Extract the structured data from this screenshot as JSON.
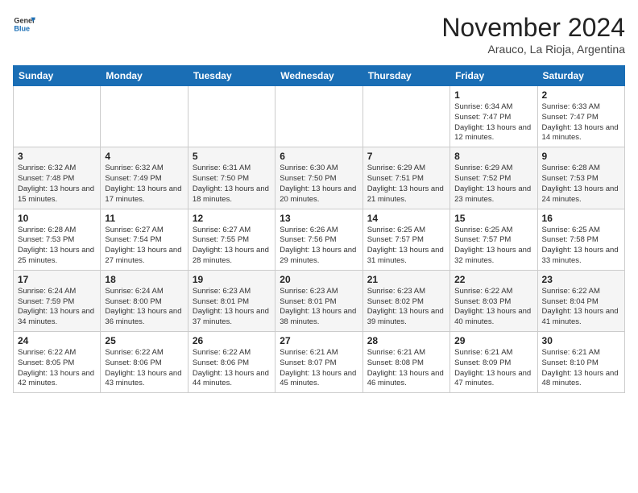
{
  "logo": {
    "line1": "General",
    "line2": "Blue"
  },
  "title": "November 2024",
  "subtitle": "Arauco, La Rioja, Argentina",
  "headers": [
    "Sunday",
    "Monday",
    "Tuesday",
    "Wednesday",
    "Thursday",
    "Friday",
    "Saturday"
  ],
  "weeks": [
    [
      {
        "day": "",
        "info": ""
      },
      {
        "day": "",
        "info": ""
      },
      {
        "day": "",
        "info": ""
      },
      {
        "day": "",
        "info": ""
      },
      {
        "day": "",
        "info": ""
      },
      {
        "day": "1",
        "info": "Sunrise: 6:34 AM\nSunset: 7:47 PM\nDaylight: 13 hours and 12 minutes."
      },
      {
        "day": "2",
        "info": "Sunrise: 6:33 AM\nSunset: 7:47 PM\nDaylight: 13 hours and 14 minutes."
      }
    ],
    [
      {
        "day": "3",
        "info": "Sunrise: 6:32 AM\nSunset: 7:48 PM\nDaylight: 13 hours and 15 minutes."
      },
      {
        "day": "4",
        "info": "Sunrise: 6:32 AM\nSunset: 7:49 PM\nDaylight: 13 hours and 17 minutes."
      },
      {
        "day": "5",
        "info": "Sunrise: 6:31 AM\nSunset: 7:50 PM\nDaylight: 13 hours and 18 minutes."
      },
      {
        "day": "6",
        "info": "Sunrise: 6:30 AM\nSunset: 7:50 PM\nDaylight: 13 hours and 20 minutes."
      },
      {
        "day": "7",
        "info": "Sunrise: 6:29 AM\nSunset: 7:51 PM\nDaylight: 13 hours and 21 minutes."
      },
      {
        "day": "8",
        "info": "Sunrise: 6:29 AM\nSunset: 7:52 PM\nDaylight: 13 hours and 23 minutes."
      },
      {
        "day": "9",
        "info": "Sunrise: 6:28 AM\nSunset: 7:53 PM\nDaylight: 13 hours and 24 minutes."
      }
    ],
    [
      {
        "day": "10",
        "info": "Sunrise: 6:28 AM\nSunset: 7:53 PM\nDaylight: 13 hours and 25 minutes."
      },
      {
        "day": "11",
        "info": "Sunrise: 6:27 AM\nSunset: 7:54 PM\nDaylight: 13 hours and 27 minutes."
      },
      {
        "day": "12",
        "info": "Sunrise: 6:27 AM\nSunset: 7:55 PM\nDaylight: 13 hours and 28 minutes."
      },
      {
        "day": "13",
        "info": "Sunrise: 6:26 AM\nSunset: 7:56 PM\nDaylight: 13 hours and 29 minutes."
      },
      {
        "day": "14",
        "info": "Sunrise: 6:25 AM\nSunset: 7:57 PM\nDaylight: 13 hours and 31 minutes."
      },
      {
        "day": "15",
        "info": "Sunrise: 6:25 AM\nSunset: 7:57 PM\nDaylight: 13 hours and 32 minutes."
      },
      {
        "day": "16",
        "info": "Sunrise: 6:25 AM\nSunset: 7:58 PM\nDaylight: 13 hours and 33 minutes."
      }
    ],
    [
      {
        "day": "17",
        "info": "Sunrise: 6:24 AM\nSunset: 7:59 PM\nDaylight: 13 hours and 34 minutes."
      },
      {
        "day": "18",
        "info": "Sunrise: 6:24 AM\nSunset: 8:00 PM\nDaylight: 13 hours and 36 minutes."
      },
      {
        "day": "19",
        "info": "Sunrise: 6:23 AM\nSunset: 8:01 PM\nDaylight: 13 hours and 37 minutes."
      },
      {
        "day": "20",
        "info": "Sunrise: 6:23 AM\nSunset: 8:01 PM\nDaylight: 13 hours and 38 minutes."
      },
      {
        "day": "21",
        "info": "Sunrise: 6:23 AM\nSunset: 8:02 PM\nDaylight: 13 hours and 39 minutes."
      },
      {
        "day": "22",
        "info": "Sunrise: 6:22 AM\nSunset: 8:03 PM\nDaylight: 13 hours and 40 minutes."
      },
      {
        "day": "23",
        "info": "Sunrise: 6:22 AM\nSunset: 8:04 PM\nDaylight: 13 hours and 41 minutes."
      }
    ],
    [
      {
        "day": "24",
        "info": "Sunrise: 6:22 AM\nSunset: 8:05 PM\nDaylight: 13 hours and 42 minutes."
      },
      {
        "day": "25",
        "info": "Sunrise: 6:22 AM\nSunset: 8:06 PM\nDaylight: 13 hours and 43 minutes."
      },
      {
        "day": "26",
        "info": "Sunrise: 6:22 AM\nSunset: 8:06 PM\nDaylight: 13 hours and 44 minutes."
      },
      {
        "day": "27",
        "info": "Sunrise: 6:21 AM\nSunset: 8:07 PM\nDaylight: 13 hours and 45 minutes."
      },
      {
        "day": "28",
        "info": "Sunrise: 6:21 AM\nSunset: 8:08 PM\nDaylight: 13 hours and 46 minutes."
      },
      {
        "day": "29",
        "info": "Sunrise: 6:21 AM\nSunset: 8:09 PM\nDaylight: 13 hours and 47 minutes."
      },
      {
        "day": "30",
        "info": "Sunrise: 6:21 AM\nSunset: 8:10 PM\nDaylight: 13 hours and 48 minutes."
      }
    ]
  ]
}
